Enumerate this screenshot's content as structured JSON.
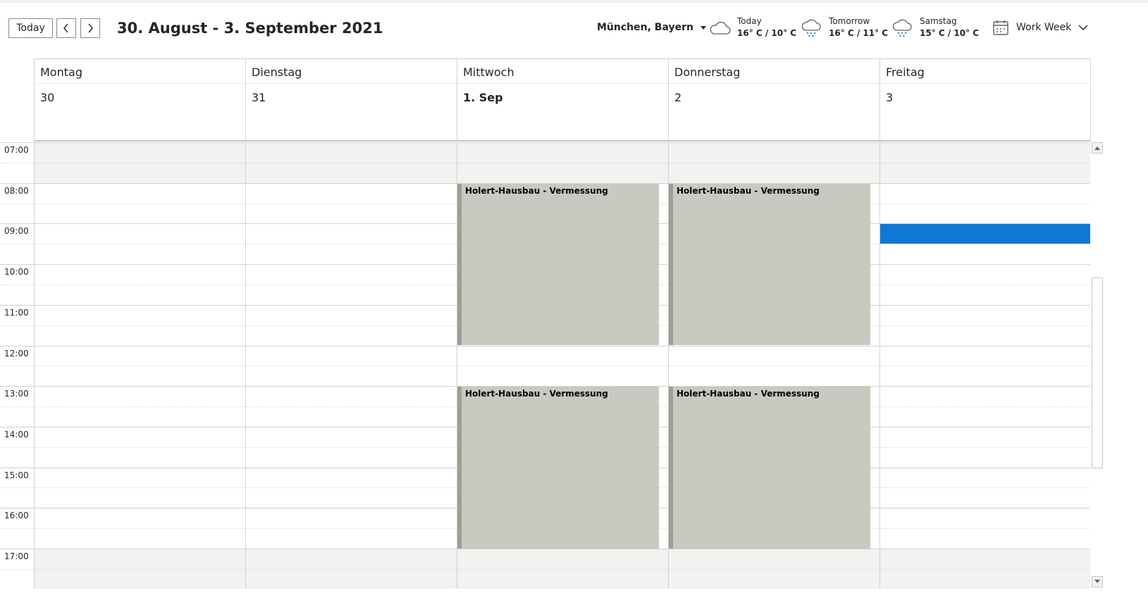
{
  "toolbar": {
    "today_label": "Today",
    "date_range": "30. August - 3. September 2021",
    "location": "München, Bayern",
    "weather": [
      {
        "day": "Today",
        "temp": "16° C / 10° C",
        "icon": "cloud-icon"
      },
      {
        "day": "Tomorrow",
        "temp": "16° C / 11° C",
        "icon": "rain-cloud-icon"
      },
      {
        "day": "Samstag",
        "temp": "15° C / 10° C",
        "icon": "rain-cloud-icon"
      }
    ],
    "view_label": "Work Week"
  },
  "days": [
    {
      "name": "Montag",
      "date": "30",
      "today": false
    },
    {
      "name": "Dienstag",
      "date": "31",
      "today": false
    },
    {
      "name": "Mittwoch",
      "date": "1. Sep",
      "today": true
    },
    {
      "name": "Donnerstag",
      "date": "2",
      "today": false
    },
    {
      "name": "Freitag",
      "date": "3",
      "today": false
    }
  ],
  "hours": [
    "07:00",
    "08:00",
    "09:00",
    "10:00",
    "11:00",
    "12:00",
    "13:00",
    "14:00",
    "15:00",
    "16:00",
    "17:00"
  ],
  "work_hours": {
    "start": "08:00",
    "end": "17:00"
  },
  "events": [
    {
      "day": 2,
      "start": "08:00",
      "end": "12:00",
      "title": "Holert-Hausbau - Vermessung",
      "color": "#c8c9c1"
    },
    {
      "day": 3,
      "start": "08:00",
      "end": "12:00",
      "title": "Holert-Hausbau - Vermessung",
      "color": "#c8c9c1"
    },
    {
      "day": 2,
      "start": "13:00",
      "end": "17:00",
      "title": "Holert-Hausbau - Vermessung",
      "color": "#c8c9c1"
    },
    {
      "day": 3,
      "start": "13:00",
      "end": "17:00",
      "title": "Holert-Hausbau - Vermessung",
      "color": "#c8c9c1"
    },
    {
      "day": 4,
      "start": "09:00",
      "end": "09:30",
      "title": "",
      "color": "#0f78d4"
    }
  ],
  "colors": {
    "accent": "#0f78d4",
    "offhours": "#f3f2f1",
    "event_gray": "#c8c9c1"
  }
}
